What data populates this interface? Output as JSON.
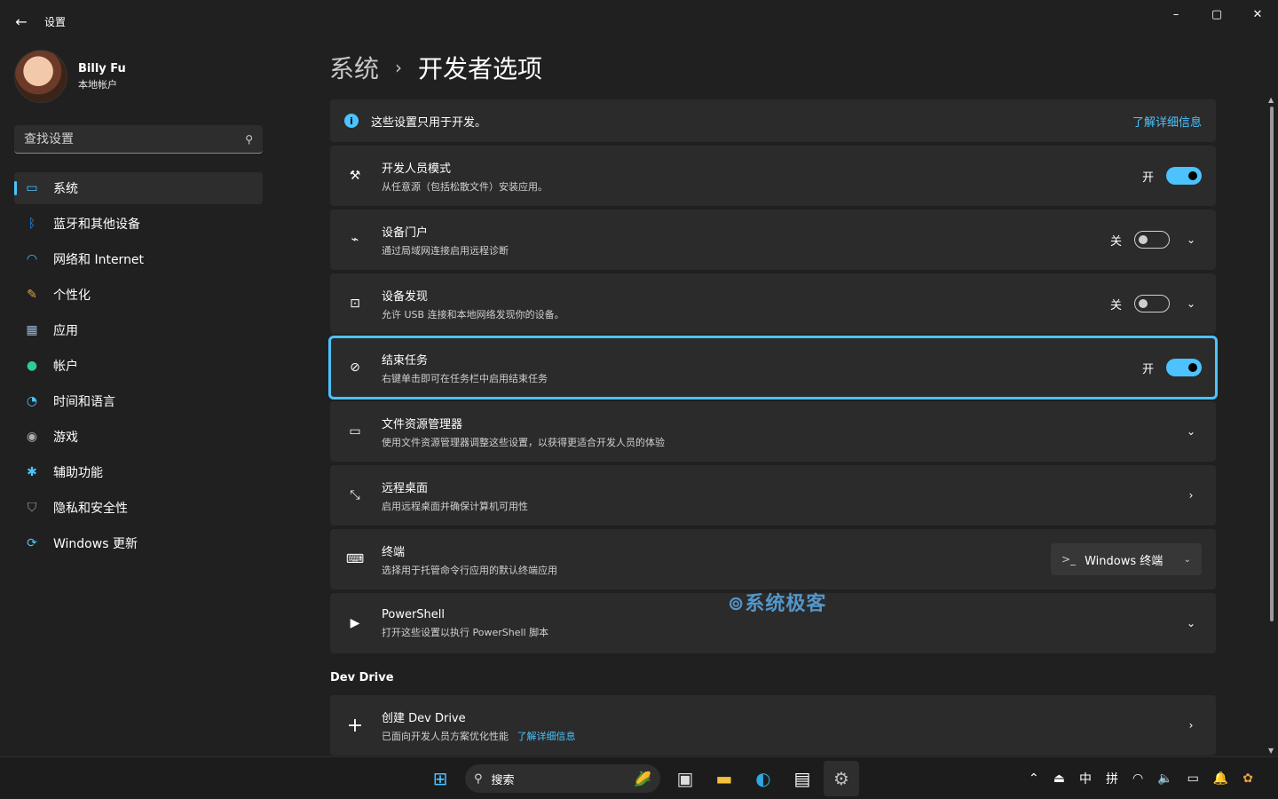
{
  "window": {
    "title": "设置",
    "back_icon": "back-arrow-icon"
  },
  "window_controls": {
    "minimize": "–",
    "maximize": "▢",
    "close": "✕"
  },
  "profile": {
    "name": "Billy Fu",
    "account_type": "本地帐户"
  },
  "search": {
    "placeholder": "查找设置"
  },
  "sidebar": {
    "items": [
      {
        "label": "系统",
        "icon": "system-icon",
        "glyph": "▭",
        "color": "#4cc2ff",
        "active": true
      },
      {
        "label": "蓝牙和其他设备",
        "icon": "bluetooth-icon",
        "glyph": "ᛒ",
        "color": "#1e90ff"
      },
      {
        "label": "网络和 Internet",
        "icon": "wifi-icon",
        "glyph": "◠",
        "color": "#4cc2ff"
      },
      {
        "label": "个性化",
        "icon": "brush-icon",
        "glyph": "✎",
        "color": "#e8a33d"
      },
      {
        "label": "应用",
        "icon": "apps-icon",
        "glyph": "▦",
        "color": "#9ab3d5"
      },
      {
        "label": "帐户",
        "icon": "account-icon",
        "glyph": "●",
        "color": "#2ecc9a"
      },
      {
        "label": "时间和语言",
        "icon": "clock-globe-icon",
        "glyph": "◔",
        "color": "#4cc2ff"
      },
      {
        "label": "游戏",
        "icon": "gamepad-icon",
        "glyph": "◉",
        "color": "#b0b0b0"
      },
      {
        "label": "辅助功能",
        "icon": "accessibility-icon",
        "glyph": "✱",
        "color": "#4cc2ff"
      },
      {
        "label": "隐私和安全性",
        "icon": "shield-icon",
        "glyph": "⛉",
        "color": "#a0a0a0"
      },
      {
        "label": "Windows 更新",
        "icon": "update-icon",
        "glyph": "⟳",
        "color": "#4cc2ff"
      }
    ]
  },
  "breadcrumb": {
    "parent": "系统",
    "separator": "›",
    "current": "开发者选项"
  },
  "info_bar": {
    "text": "这些设置只用于开发。",
    "link": "了解详细信息"
  },
  "cards": [
    {
      "title": "开发人员模式",
      "desc": "从任意源（包括松散文件）安装应用。",
      "icon": "dev-tools-icon",
      "glyph": "⚒",
      "control": "toggle",
      "state": "开",
      "on": true
    },
    {
      "title": "设备门户",
      "desc": "通过局域网连接启用远程诊断",
      "icon": "device-portal-icon",
      "glyph": "⌁",
      "control": "toggle",
      "state": "关",
      "on": false,
      "chevron": "⌄"
    },
    {
      "title": "设备发现",
      "desc": "允许 USB 连接和本地网络发现你的设备。",
      "icon": "device-discovery-icon",
      "glyph": "⊡",
      "control": "toggle",
      "state": "关",
      "on": false,
      "chevron": "⌄"
    },
    {
      "title": "结束任务",
      "desc": "右键单击即可在任务栏中启用结束任务",
      "icon": "end-task-icon",
      "glyph": "⊘",
      "control": "toggle",
      "state": "开",
      "on": true,
      "focused": true
    },
    {
      "title": "文件资源管理器",
      "desc": "使用文件资源管理器调整这些设置，以获得更适合开发人员的体验",
      "icon": "folder-icon",
      "glyph": "▭",
      "chevron": "⌄"
    },
    {
      "title": "远程桌面",
      "desc": "启用远程桌面并确保计算机可用性",
      "icon": "remote-desktop-icon",
      "glyph": "⤡",
      "chevron": "›"
    },
    {
      "title": "终端",
      "desc": "选择用于托管命令行应用的默认终端应用",
      "icon": "terminal-icon",
      "glyph": "⌨",
      "control": "dropdown",
      "dropdown_value": "Windows 终端"
    },
    {
      "title": "PowerShell",
      "desc": "打开这些设置以执行 PowerShell 脚本",
      "icon": "powershell-icon",
      "glyph": "▶",
      "chevron": "⌄"
    }
  ],
  "dev_drive": {
    "section_title": "Dev Drive",
    "title": "创建 Dev Drive",
    "desc": "已面向开发人员方案优化性能",
    "link": "了解详细信息",
    "icon": "plus-icon",
    "chevron": "›"
  },
  "watermark": "⊚系统极客",
  "taskbar": {
    "search_label": "搜索",
    "apps": [
      "start-icon",
      "task-view-icon",
      "file-explorer-icon",
      "edge-icon",
      "store-icon",
      "settings-icon"
    ],
    "tray": {
      "ime_1": "中",
      "ime_2": "拼"
    }
  }
}
